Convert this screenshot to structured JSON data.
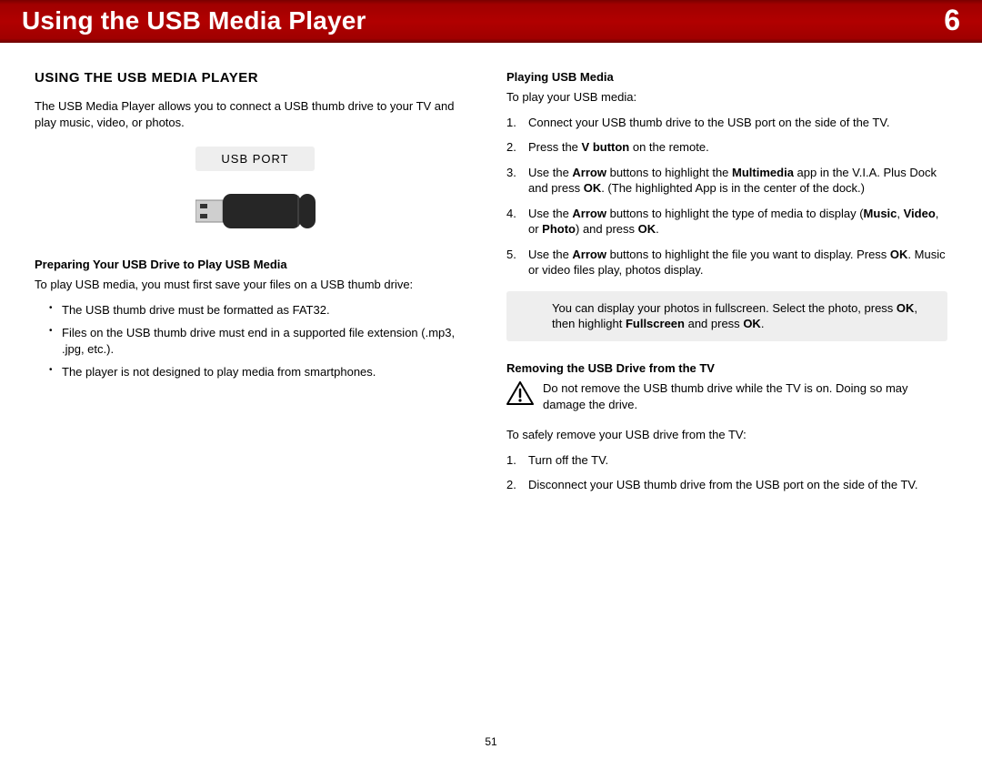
{
  "header": {
    "title": "Using the USB Media Player",
    "chapter": "6"
  },
  "left": {
    "section_title": "USING THE USB MEDIA PLAYER",
    "intro": "The USB Media Player allows you to connect a USB thumb drive to your TV and play music, video, or photos.",
    "usb_port_label": "USB PORT",
    "prep_head": "Preparing Your USB Drive to Play USB Media",
    "prep_intro": "To play USB media, you must first save your files on a USB thumb drive:",
    "prep_items": {
      "0": "The USB thumb drive must be formatted as FAT32.",
      "1": "Files on the USB thumb drive must end in a supported file extension (.mp3, .jpg, etc.).",
      "2": "The player is not designed to play media from smartphones."
    }
  },
  "right": {
    "play_head": "Playing USB Media",
    "play_intro": "To play your USB media:",
    "step1": "Connect your USB thumb drive to the USB port on the side of the TV.",
    "step2_a": "Press the ",
    "step2_b": "V button",
    "step2_c": " on the remote.",
    "step3_a": "Use the ",
    "step3_b": "Arrow",
    "step3_c": " buttons to highlight the ",
    "step3_d": "Multimedia",
    "step3_e": " app in the V.I.A. Plus Dock and press ",
    "step3_f": "OK",
    "step3_g": ". (The highlighted App is in the center of the dock.)",
    "step4_a": "Use the ",
    "step4_b": "Arrow",
    "step4_c": " buttons to highlight the type of media to display (",
    "step4_d": "Music",
    "step4_e": ", ",
    "step4_f": "Video",
    "step4_g": ", or ",
    "step4_h": "Photo",
    "step4_i": ") and press ",
    "step4_j": "OK",
    "step4_k": ".",
    "step5_a": "Use the ",
    "step5_b": "Arrow",
    "step5_c": " buttons to highlight the file you want to display. Press ",
    "step5_d": "OK",
    "step5_e": ". Music or video files play, photos display.",
    "note_a": "You can display your photos in fullscreen. Select the photo, press ",
    "note_b": "OK",
    "note_c": ", then highlight ",
    "note_d": "Fullscreen",
    "note_e": " and press ",
    "note_f": "OK",
    "note_g": ".",
    "remove_head": "Removing the USB Drive from the TV",
    "warn": "Do not remove the USB thumb drive while the TV is on. Doing so may damage the drive.",
    "remove_intro": "To safely remove your USB drive from the TV:",
    "rstep1": "Turn off the TV.",
    "rstep2": "Disconnect your USB thumb drive from the USB port on the side of the TV."
  },
  "page_number": "51"
}
